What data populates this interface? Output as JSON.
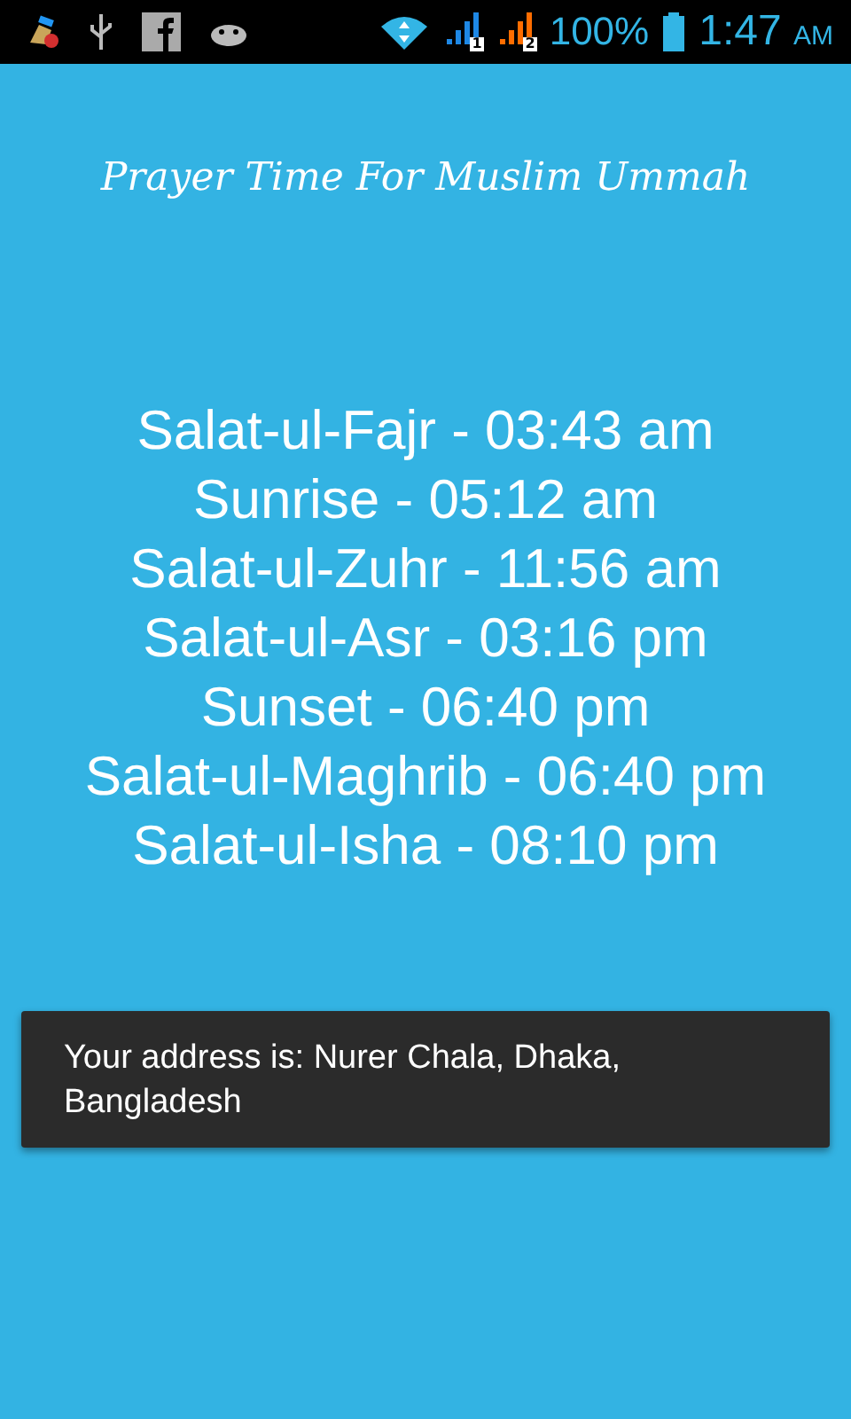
{
  "status_bar": {
    "sims": [
      {
        "label": "1",
        "color": "#1e88e5"
      },
      {
        "label": "2",
        "color": "#ff6d00"
      }
    ],
    "battery": "100%",
    "time": "1:47",
    "meridiem": "AM"
  },
  "title": "Prayer Time For Muslim Ummah",
  "prayers": [
    "Salat-ul-Fajr - 03:43 am",
    "Sunrise - 05:12 am",
    "Salat-ul-Zuhr - 11:56 am",
    "Salat-ul-Asr - 03:16 pm",
    "Sunset - 06:40 pm",
    "Salat-ul-Maghrib - 06:40 pm",
    "Salat-ul-Isha - 08:10 pm"
  ],
  "toast": "Your address is: Nurer Chala, Dhaka, Bangladesh"
}
